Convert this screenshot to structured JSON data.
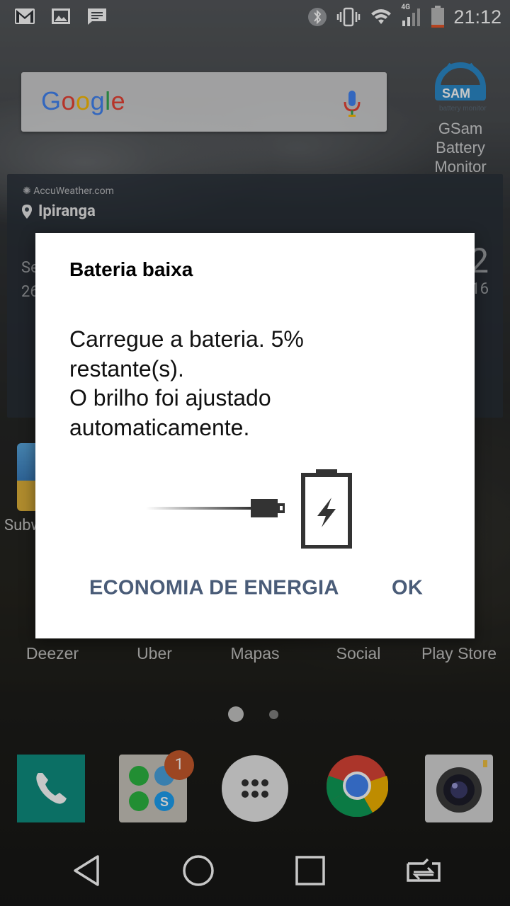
{
  "status_bar": {
    "time": "21:12",
    "network": "4G",
    "battery_percent": 5,
    "icons": [
      "gmail-icon",
      "gallery-icon",
      "message-icon",
      "bluetooth-icon",
      "vibrate-icon",
      "wifi-icon",
      "signal-icon",
      "battery-icon"
    ]
  },
  "home": {
    "search": {
      "logo": "Google"
    },
    "gsam": {
      "logo_text": "SAM",
      "logo_subtext": "battery monitor",
      "label_line1": "GSam Battery",
      "label_line2": "Monitor"
    },
    "weather": {
      "source": "AccuWeather.com",
      "city": "Ipiranga",
      "left_line1": "Se",
      "left_line2": "26",
      "right_big": "2",
      "right_small": "16"
    },
    "subway_label": "Subw",
    "apps": [
      "Deezer",
      "Uber",
      "Mapas",
      "Social",
      "Play Store"
    ],
    "folder_badge": "1"
  },
  "dialog": {
    "title": "Bateria baixa",
    "message_lines": [
      "Carregue a bateria. 5%",
      "restante(s).",
      "O brilho foi ajustado",
      "automaticamente."
    ],
    "buttons": {
      "power_saving": "ECONOMIA DE ENERGIA",
      "ok": "OK"
    }
  },
  "colors": {
    "dialog_button": "#4a5c78",
    "battery_low": "#e8572a",
    "badge": "#c85a2c"
  }
}
